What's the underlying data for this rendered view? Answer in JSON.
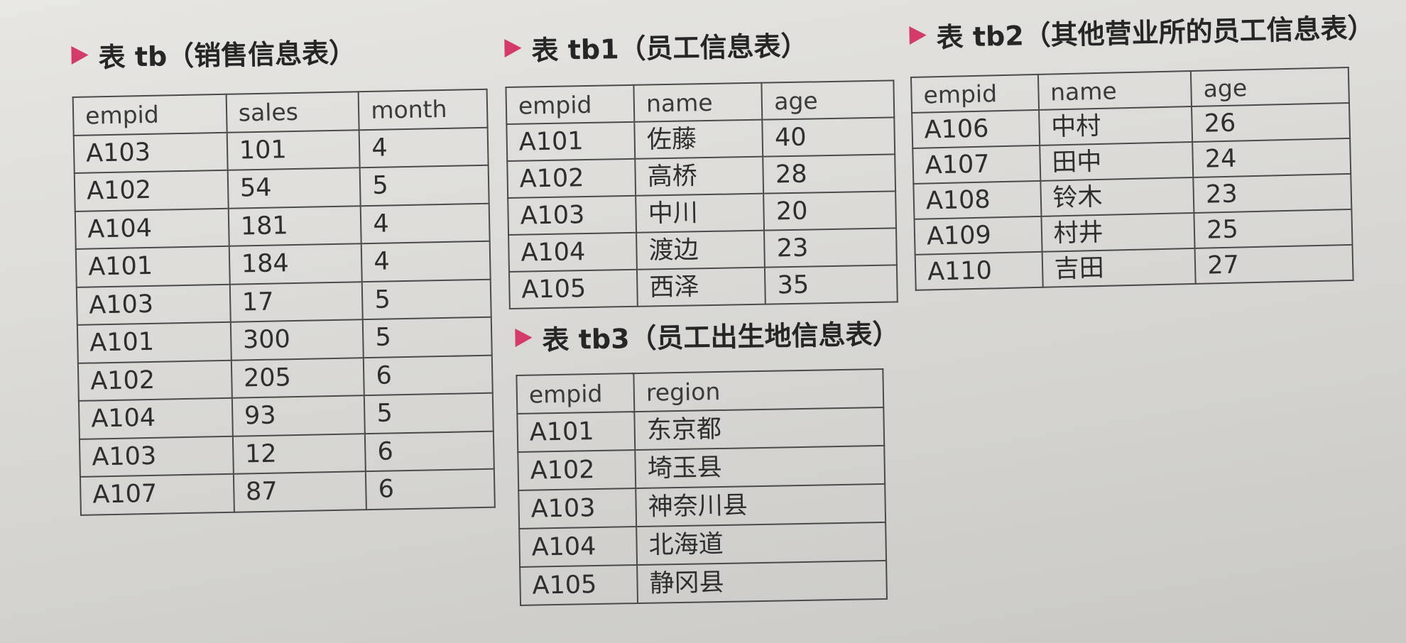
{
  "tables": [
    {
      "id": "tb",
      "title": "表 tb（销售信息表）",
      "headers": [
        "empid",
        "sales",
        "month"
      ],
      "rows": [
        [
          "A103",
          "101",
          "4"
        ],
        [
          "A102",
          "54",
          "5"
        ],
        [
          "A104",
          "181",
          "4"
        ],
        [
          "A101",
          "184",
          "4"
        ],
        [
          "A103",
          "17",
          "5"
        ],
        [
          "A101",
          "300",
          "5"
        ],
        [
          "A102",
          "205",
          "6"
        ],
        [
          "A104",
          "93",
          "5"
        ],
        [
          "A103",
          "12",
          "6"
        ],
        [
          "A107",
          "87",
          "6"
        ]
      ]
    },
    {
      "id": "tb1",
      "title": "表 tb1（员工信息表）",
      "headers": [
        "empid",
        "name",
        "age"
      ],
      "rows": [
        [
          "A101",
          "佐藤",
          "40"
        ],
        [
          "A102",
          "高桥",
          "28"
        ],
        [
          "A103",
          "中川",
          "20"
        ],
        [
          "A104",
          "渡边",
          "23"
        ],
        [
          "A105",
          "西泽",
          "35"
        ]
      ]
    },
    {
      "id": "tb2",
      "title": "表 tb2（其他营业所的员工信息表）",
      "headers": [
        "empid",
        "name",
        "age"
      ],
      "rows": [
        [
          "A106",
          "中村",
          "26"
        ],
        [
          "A107",
          "田中",
          "24"
        ],
        [
          "A108",
          "铃木",
          "23"
        ],
        [
          "A109",
          "村井",
          "25"
        ],
        [
          "A110",
          "吉田",
          "27"
        ]
      ]
    },
    {
      "id": "tb3",
      "title": "表 tb3（员工出生地信息表）",
      "headers": [
        "empid",
        "region"
      ],
      "rows": [
        [
          "A101",
          "东京都"
        ],
        [
          "A102",
          "埼玉县"
        ],
        [
          "A103",
          "神奈川县"
        ],
        [
          "A104",
          "北海道"
        ],
        [
          "A105",
          "静冈县"
        ]
      ]
    }
  ],
  "colors": {
    "arrow": "#d43a6a",
    "border": "#4a4a4a",
    "text": "#2e2e2e"
  },
  "icons": {
    "heading_marker": "triangle-right-icon"
  }
}
